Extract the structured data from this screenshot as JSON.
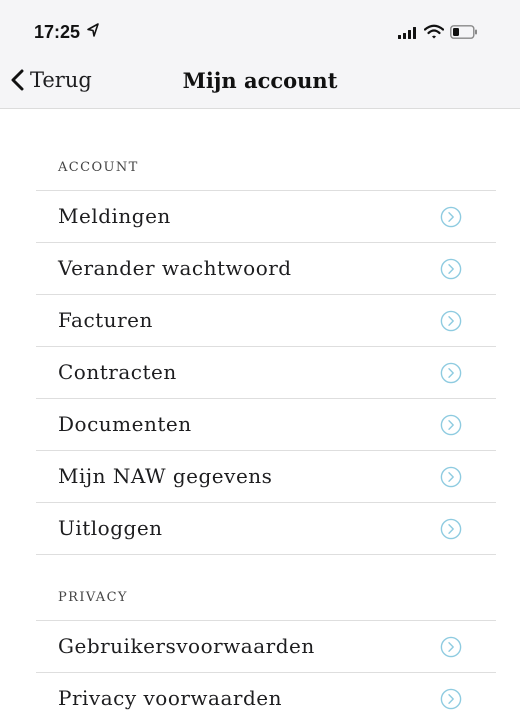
{
  "status_bar": {
    "time": "17:25",
    "icons": [
      "location-arrow-icon",
      "signal-icon",
      "wifi-icon",
      "battery-icon"
    ]
  },
  "nav": {
    "back_label": "Terug",
    "title": "Mijn account"
  },
  "sections": [
    {
      "header": "ACCOUNT",
      "items": [
        {
          "label": "Meldingen"
        },
        {
          "label": "Verander wachtwoord"
        },
        {
          "label": "Facturen"
        },
        {
          "label": "Contracten"
        },
        {
          "label": "Documenten"
        },
        {
          "label": "Mijn NAW gegevens"
        },
        {
          "label": "Uitloggen"
        }
      ]
    },
    {
      "header": "PRIVACY",
      "items": [
        {
          "label": "Gebruikersvoorwaarden"
        },
        {
          "label": "Privacy voorwaarden"
        }
      ]
    }
  ],
  "colors": {
    "accent": "#8ecbe0",
    "bar_background": "#f5f5f7",
    "divider": "#dedede"
  }
}
